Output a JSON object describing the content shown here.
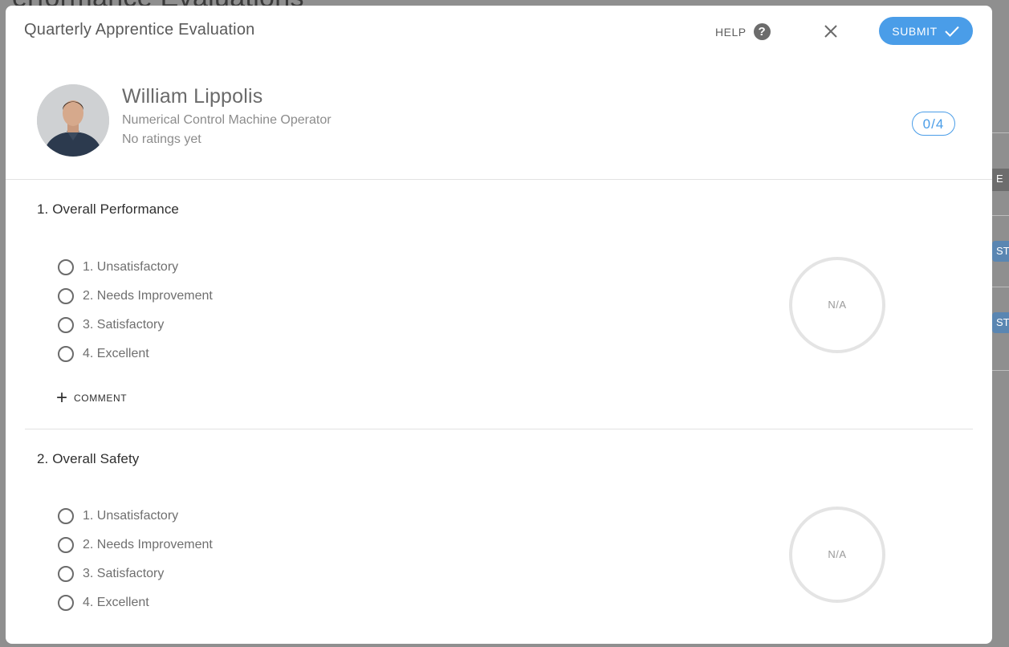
{
  "background": {
    "page_title": "Performance Evaluations",
    "side_tags": [
      "E IN",
      "ST",
      "ST"
    ]
  },
  "modal": {
    "title": "Quarterly Apprentice Evaluation",
    "help_label": "HELP",
    "submit_label": "SUBMIT",
    "accent_color": "#4a9de8"
  },
  "profile": {
    "name": "William Lippolis",
    "role": "Numerical Control Machine Operator",
    "rating_status": "No ratings yet",
    "score": "0/4"
  },
  "questions": [
    {
      "title": "1. Overall Performance",
      "options": [
        "1. Unsatisfactory",
        "2. Needs Improvement",
        "3. Satisfactory",
        "4. Excellent"
      ],
      "score_display": "N/A",
      "comment_label": "COMMENT"
    },
    {
      "title": "2. Overall Safety",
      "options": [
        "1. Unsatisfactory",
        "2. Needs Improvement",
        "3. Satisfactory",
        "4. Excellent"
      ],
      "score_display": "N/A"
    }
  ]
}
